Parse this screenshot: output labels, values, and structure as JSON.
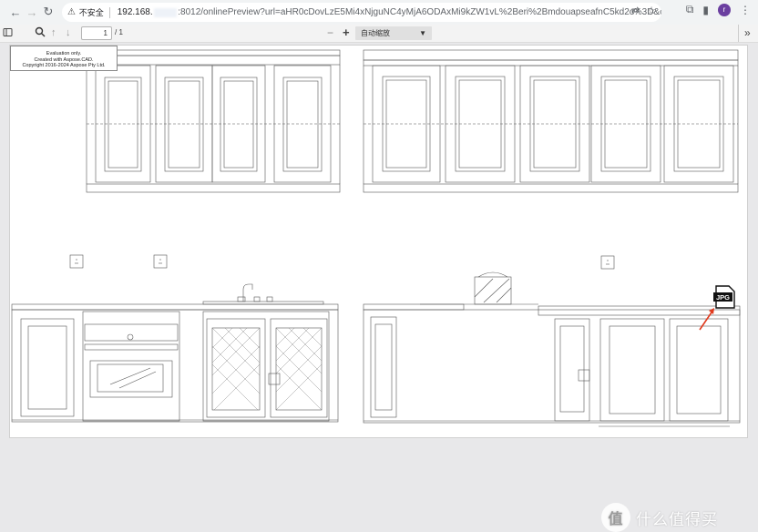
{
  "browser": {
    "back_icon": "arrow-left-icon",
    "forward_icon": "arrow-right-icon",
    "reload_icon": "reload-icon",
    "insecure_label": "不安全",
    "url_host": "192.168.",
    "url_path": ":8012/onlinePreview?url=aHR0cDovLzE5Mi4xNjguNC4yMjA6ODAxMi9kZW1vL%2Beri%2BmdouapseafnC5kd2c%3D&officePrev...",
    "profile_initial": "r"
  },
  "pdf_toolbar": {
    "current_page": "1",
    "total_pages": "/ 1",
    "zoom_option": "自动缩放",
    "zoom_out_symbol": "−",
    "zoom_in_symbol": "+",
    "more_symbol": "»"
  },
  "document": {
    "eval_line1": "Evaluation only.",
    "eval_line2": "Created with Aspose.CAD.",
    "eval_line3": "Copyright 2016-2024 Aspose Pty Ltd.",
    "jpg_label": "JPG"
  },
  "watermark": {
    "badge": "值",
    "text": "什么值得买"
  },
  "colors": {
    "accent_arrow": "#e03a1e",
    "line": "#555555"
  }
}
